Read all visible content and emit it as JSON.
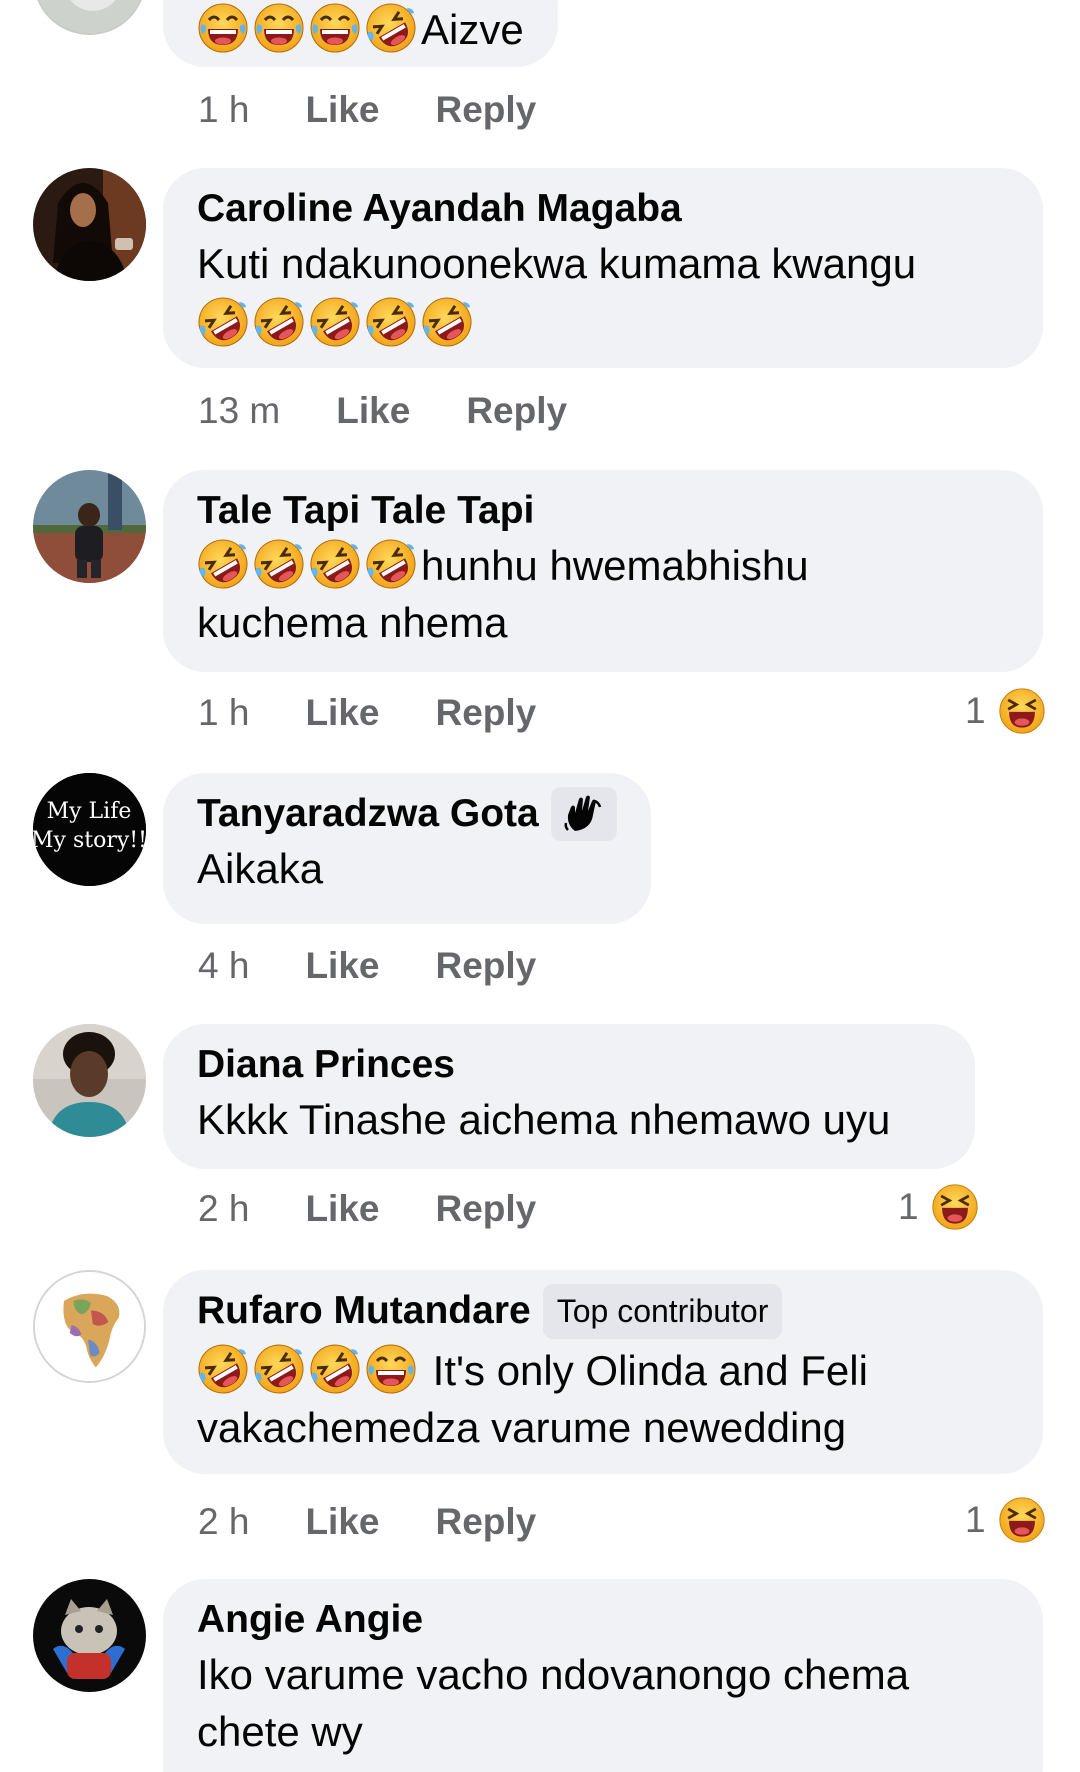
{
  "comments": [
    {
      "author": "",
      "text": "Aizve",
      "emojis": [
        "laughing-tears",
        "laughing-tears",
        "laughing-tears",
        "rolling-laughing"
      ],
      "time": "1 h",
      "like_label": "Like",
      "reply_label": "Reply"
    },
    {
      "author": "Caroline Ayandah Magaba",
      "text": "Kuti ndakunoonekwa kumama kwangu",
      "emojis": [
        "rolling-laughing",
        "rolling-laughing",
        "rolling-laughing",
        "rolling-laughing",
        "rolling-laughing"
      ],
      "time": "13 m",
      "like_label": "Like",
      "reply_label": "Reply"
    },
    {
      "author": "Tale Tapi Tale Tapi",
      "text_line1": "hunhu hwemabhishu",
      "text_line2": "kuchema nhema",
      "emojis": [
        "rolling-laughing",
        "rolling-laughing",
        "rolling-laughing",
        "rolling-laughing"
      ],
      "time": "1 h",
      "like_label": "Like",
      "reply_label": "Reply",
      "reaction_count": "1",
      "reaction_icon": "squinting-laugh-icon"
    },
    {
      "author": "Tanyaradzwa Gota",
      "badge_icon": "waving-hand-icon",
      "text": "Aikaka",
      "avatar_text_line1": "My Life",
      "avatar_text_line2": "My story!!",
      "time": "4 h",
      "like_label": "Like",
      "reply_label": "Reply"
    },
    {
      "author": "Diana Princes",
      "text": "Kkkk Tinashe aichema nhemawo uyu",
      "time": "2 h",
      "like_label": "Like",
      "reply_label": "Reply",
      "reaction_count": "1",
      "reaction_icon": "squinting-laugh-icon"
    },
    {
      "author": "Rufaro Mutandare",
      "badge": "Top contributor",
      "text_line1": "It's only Olinda and Feli",
      "text_line2": "vakachemedza varume newedding",
      "emojis": [
        "rolling-laughing",
        "rolling-laughing",
        "rolling-laughing",
        "laughing-tears"
      ],
      "time": "2 h",
      "like_label": "Like",
      "reply_label": "Reply",
      "reaction_count": "1",
      "reaction_icon": "squinting-laugh-icon"
    },
    {
      "author": "Angie Angie",
      "text_line1": "Iko varume vacho ndovanongo chema",
      "text_line2": "chete wy"
    }
  ],
  "colors": {
    "bubble": "#f0f2f5",
    "meta_text": "#65676b",
    "text": "#050505",
    "emoji_face": "#f7b125",
    "emoji_mouth": "#b11e22"
  }
}
